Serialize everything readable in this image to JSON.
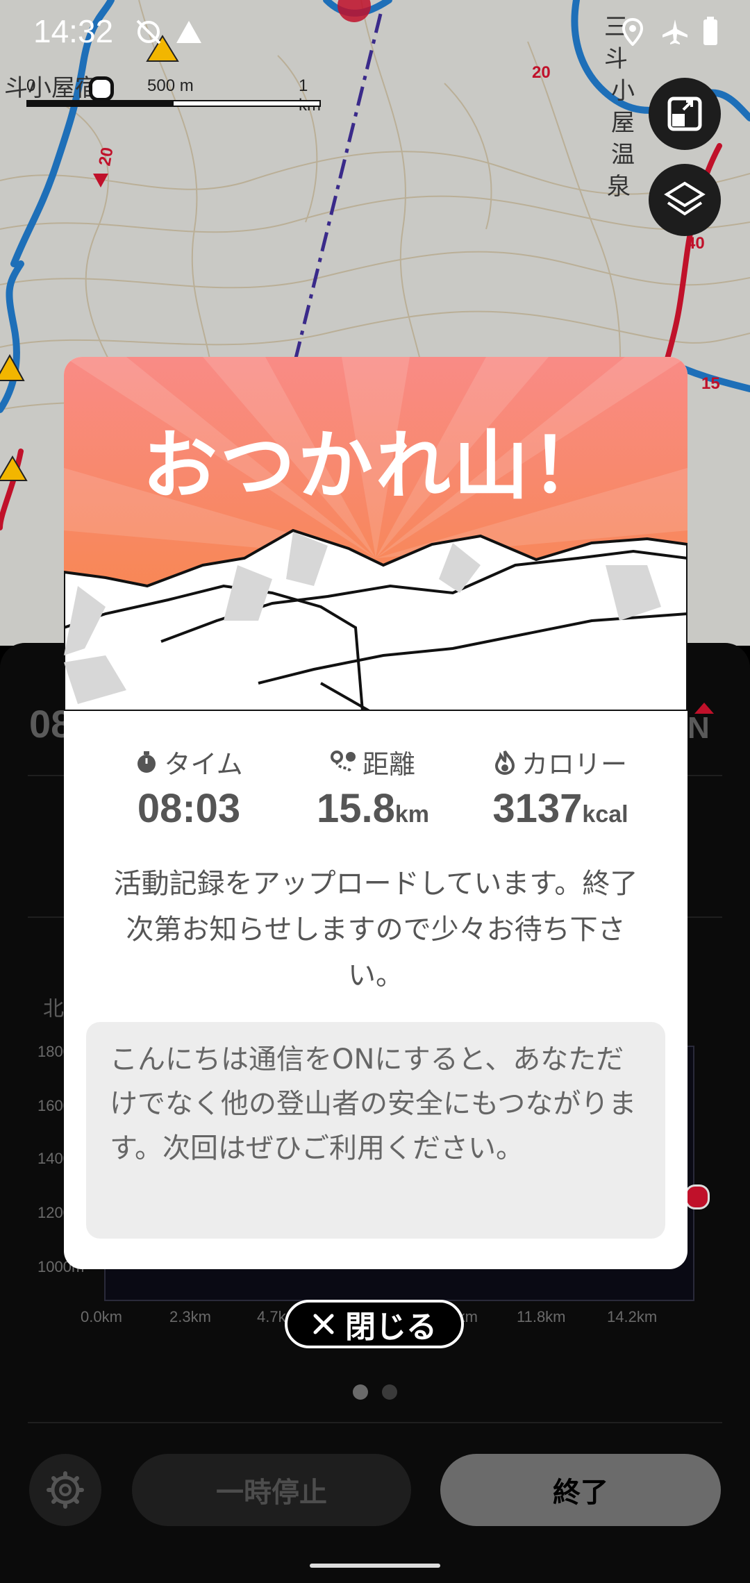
{
  "status_bar": {
    "time": "14:32",
    "icons": [
      "sync-off-icon",
      "signal-icon",
      "location-icon",
      "airplane-icon",
      "battery-icon"
    ]
  },
  "map": {
    "scale_labels": [
      "0",
      "500 m",
      "1 km"
    ],
    "place_labels": [
      "斗小屋宿",
      "三斗小屋温泉"
    ],
    "route_numbers": [
      "20",
      "20",
      "40",
      "15"
    ],
    "buttons": [
      "fullscreen-icon",
      "layers-icon"
    ]
  },
  "panel": {
    "time_partial": "08",
    "heading_partial": "N",
    "compass_partial": "北",
    "chart_y_ticks": [
      "1800",
      "1600",
      "1400",
      "1200",
      "1000m"
    ],
    "chart_x_ticks": [
      "0.0km",
      "2.3km",
      "4.7km",
      "9.5km",
      "11.8km",
      "14.2km"
    ],
    "pause_label": "一時停止",
    "end_label": "終了"
  },
  "modal": {
    "title": "おつかれ山！",
    "stats": [
      {
        "label": "タイム",
        "value": "08:03",
        "unit": "",
        "icon": "stopwatch-icon"
      },
      {
        "label": "距離",
        "value": "15.8",
        "unit": "km",
        "icon": "route-icon"
      },
      {
        "label": "カロリー",
        "value": "3137",
        "unit": "kcal",
        "icon": "flame-icon"
      }
    ],
    "upload_message": "活動記録をアップロードしています。終了次第お知らせしますので少々お待ち下さい。",
    "notice": "こんにちは通信をONにすると、あなただけでなく他の登山者の安全にもつながります。次回はぜひご利用ください。",
    "close_label": "閉じる"
  },
  "colors": {
    "banner_top": "#f98b86",
    "banner_bottom": "#f7853c",
    "route_red": "#c0112a",
    "route_blue": "#1e6fb8"
  }
}
